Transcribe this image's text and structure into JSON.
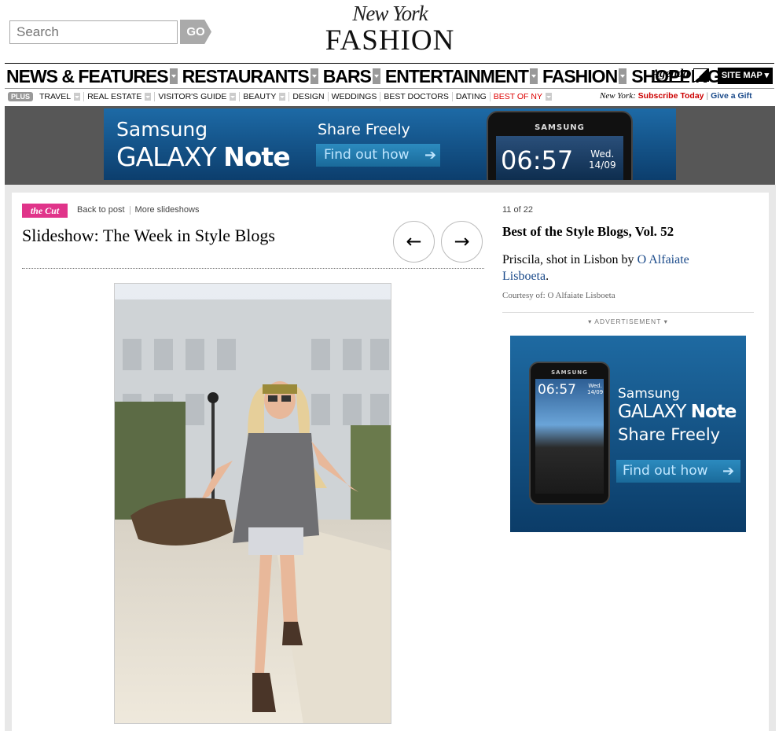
{
  "header": {
    "search_placeholder": "Search",
    "go_label": "GO",
    "logo_top": "New York",
    "logo_bottom": "FASHION"
  },
  "main_nav": {
    "items": [
      "NEWS & FEATURES",
      "RESTAURANTS",
      "BARS",
      "ENTERTAINMENT",
      "FASHION",
      "SHOPPING"
    ],
    "agenda": "Agenda",
    "site_map": "SITE MAP ▾"
  },
  "sub_nav": {
    "plus": "PLUS",
    "items": [
      "TRAVEL",
      "REAL ESTATE",
      "VISITOR'S GUIDE",
      "BEAUTY",
      "DESIGN",
      "WEDDINGS",
      "BEST DOCTORS",
      "DATING",
      "BEST OF NY"
    ],
    "ny_label": "New York:",
    "subscribe": "Subscribe Today",
    "gift": "Give a Gift"
  },
  "top_ad": {
    "brand": "Samsung",
    "product_a": "GALAXY",
    "product_b": "Note",
    "share": "Share Freely",
    "cta": "Find out how",
    "phone_brand": "SAMSUNG",
    "phone_time": "06:57",
    "phone_day": "Wed.",
    "phone_date": "14/09"
  },
  "slideshow": {
    "section_badge": "the Cut",
    "back_link": "Back to post",
    "more_link": "More slideshows",
    "title": "Slideshow: The Week in Style Blogs",
    "prev_icon": "←",
    "next_icon": "→",
    "counter": "11 of 22",
    "caption_title": "Best of the Style Blogs, Vol. 52",
    "caption_text": "Priscila, shot in Lisbon by ",
    "caption_link": "O Alfaiate Lisboeta",
    "caption_end": ".",
    "courtesy": "Courtesy of: O Alfaiate Lisboeta"
  },
  "side_ad": {
    "label": "▾  ADVERTISEMENT  ▾",
    "brand": "Samsung",
    "product_a": "GALAXY",
    "product_b": "Note",
    "share": "Share Freely",
    "cta": "Find out how",
    "phone_brand": "SAMSUNG",
    "phone_time": "06:57",
    "phone_day": "Wed.",
    "phone_date": "14/09"
  }
}
